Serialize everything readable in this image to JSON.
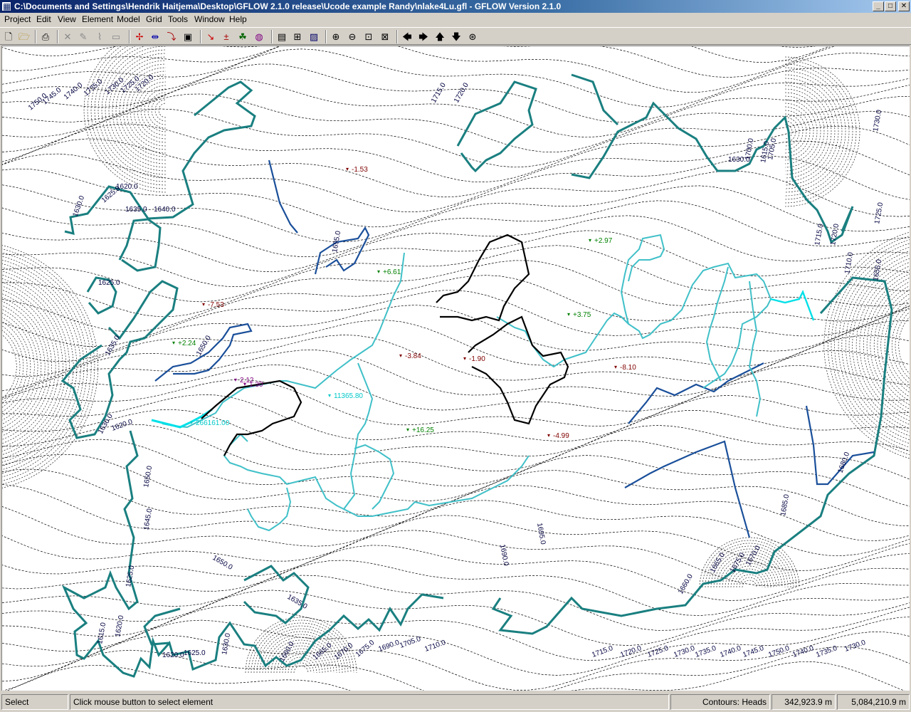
{
  "window": {
    "title": "C:\\Documents and Settings\\Hendrik Haitjema\\Desktop\\GFLOW 2.1.0 release\\Ucode example Randy\\nlake4Lu.gfl - GFLOW Version 2.1.0",
    "minimize_glyph": "_",
    "maximize_glyph": "□",
    "close_glyph": "✕"
  },
  "menu": [
    "Project",
    "Edit",
    "View",
    "Element",
    "Model",
    "Grid",
    "Tools",
    "Window",
    "Help"
  ],
  "toolbar": {
    "icons": [
      "new-file-icon",
      "open-folder-icon",
      "print-icon",
      "delete-icon",
      "edit-icon",
      "edit-line-icon",
      "edit-area-icon",
      "well-icon",
      "linesink-icon",
      "stream-icon",
      "solve-icon",
      "pathline-icon",
      "test-point-icon",
      "flow-icon",
      "target-icon",
      "calculator-icon",
      "grid-icon",
      "contour-icon",
      "zoom-in-icon",
      "zoom-out-icon",
      "zoom-window-icon",
      "zoom-extents-icon",
      "pan-left-icon",
      "pan-right-icon",
      "pan-up-icon",
      "pan-down-icon",
      "pan-center-icon"
    ],
    "glyphs": [
      "🗋",
      "🗁",
      "⎙",
      "✕",
      "✎",
      "⌇",
      "▭",
      "✢",
      "⇹",
      "⤵",
      "▣",
      "↘",
      "±",
      "☘",
      "◍",
      "▤",
      "⊞",
      "▨",
      "⊕",
      "⊖",
      "⊡",
      "⊠",
      "🡄",
      "🡆",
      "🡅",
      "🡇",
      "⊛"
    ]
  },
  "map": {
    "contour_labels": [
      "1750.0",
      "1745.0",
      "1740.0",
      "1735.0",
      "1730.0",
      "1725.0",
      "1720.0",
      "1715.0",
      "1710.0",
      "1705.0",
      "1700.0",
      "1695.0",
      "1690.0",
      "1685.0",
      "1680.0",
      "1675.0",
      "1670.0",
      "1665.0",
      "1660.0",
      "1655.0",
      "1650.0",
      "1645.0",
      "1640.0",
      "1635.0",
      "1630.0",
      "1625.0",
      "1620.0",
      "1615.0",
      "1610.0"
    ],
    "points": [
      {
        "label": "-1.53",
        "color": "#800000"
      },
      {
        "label": "+6.61",
        "color": "#008000"
      },
      {
        "label": "+2.97",
        "color": "#008000"
      },
      {
        "label": "-7.53",
        "color": "#800000"
      },
      {
        "label": "+3.75",
        "color": "#008000"
      },
      {
        "label": "+2.24",
        "color": "#008000"
      },
      {
        "label": "-3.84",
        "color": "#800000"
      },
      {
        "label": "-1.90",
        "color": "#800000"
      },
      {
        "label": "-8.10",
        "color": "#800000"
      },
      {
        "label": "2.12",
        "color": "#800080"
      },
      {
        "label": "1.30",
        "color": "#800080"
      },
      {
        "label": "11365.80",
        "color": "#00c8c8"
      },
      {
        "label": "266161.00",
        "color": "#00c8c8"
      },
      {
        "label": "+16.25",
        "color": "#008000"
      },
      {
        "label": "-4.99",
        "color": "#800000"
      }
    ]
  },
  "status": {
    "mode": "Select",
    "hint": "Click mouse button to select element",
    "contours": "Contours: Heads",
    "x_coord": "342,923.9 m",
    "y_coord": "5,084,210.9 m"
  }
}
